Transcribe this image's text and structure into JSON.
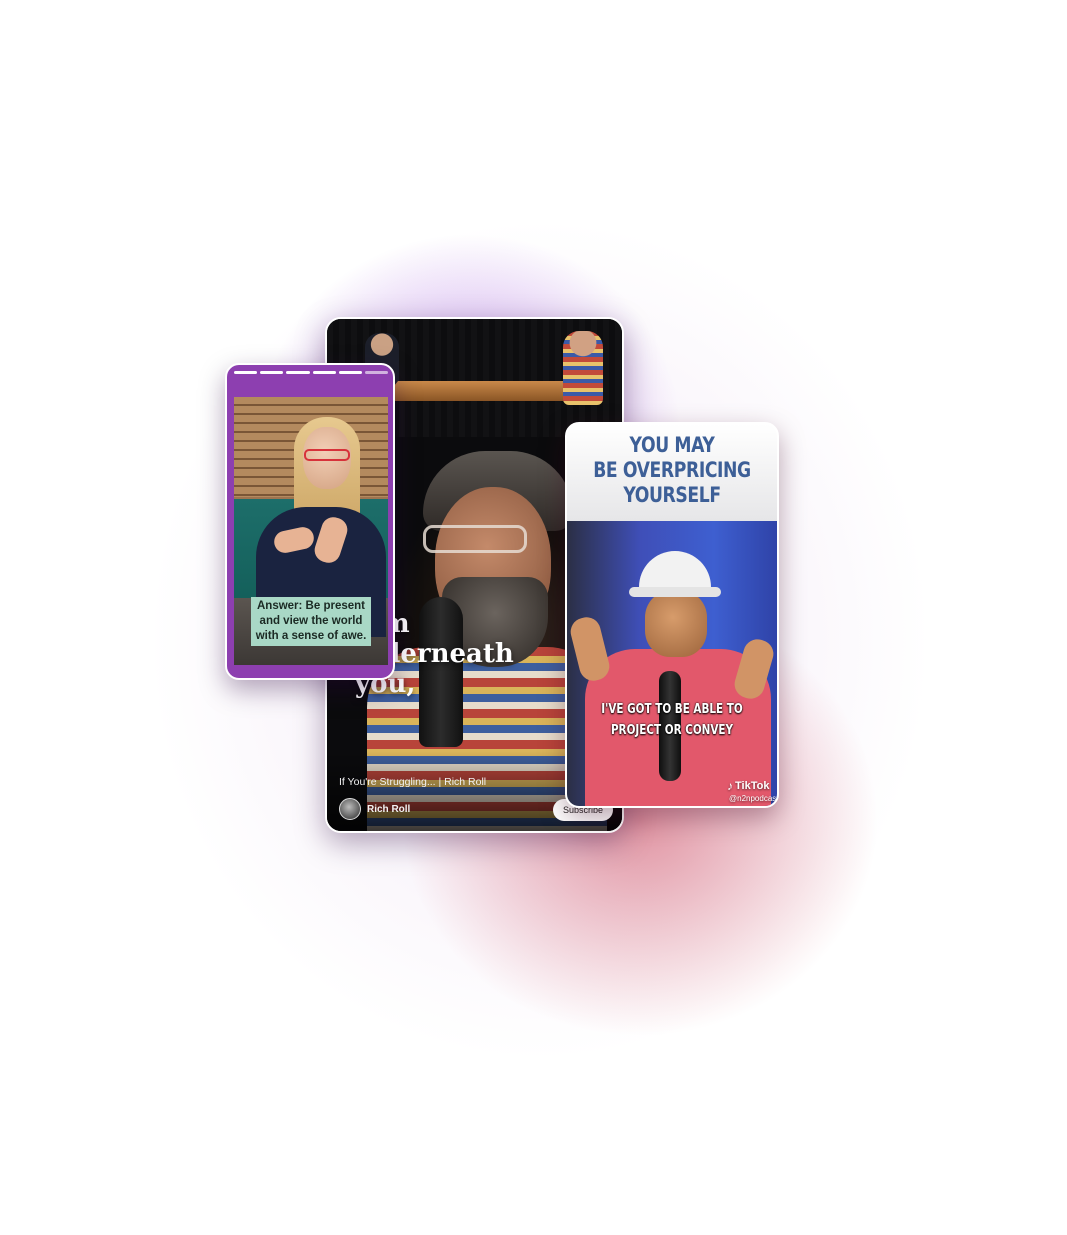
{
  "colors": {
    "glow_purple": "#9646dc",
    "glow_red": "#cd465a",
    "left_card_bg": "#8d3fb0",
    "caption_bg": "#a9d8c6",
    "headline_blue": "#3d5f97"
  },
  "center_card": {
    "quote_text": "...m\n...derneath\nyou,",
    "video_title": "If You're Struggling... | Rich Roll",
    "channel_name": "Rich Roll",
    "subscribe_label": "Subscribe"
  },
  "left_card": {
    "caption": "Answer: Be present and view the world with a sense of awe.",
    "progress_segments": 6,
    "progress_completed": 5
  },
  "right_card": {
    "headline_lines": [
      "YOU MAY",
      "BE OVERPRICING",
      "YOURSELF"
    ],
    "caption_lines": [
      "I'VE GOT TO BE ABLE TO",
      "PROJECT OR CONVEY"
    ],
    "platform_label": "TikTok",
    "handle": "@n2npodcast",
    "platform_icon": "tiktok-icon"
  }
}
